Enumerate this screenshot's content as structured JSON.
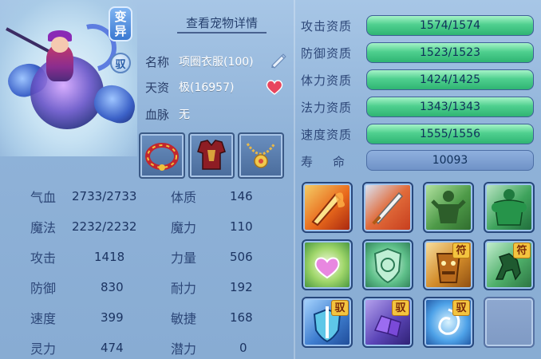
{
  "badges": {
    "mutant_top": "变",
    "mutant_bottom": "异",
    "tame": "驭"
  },
  "pet": {
    "detail_link": "查看宠物详情",
    "name_key": "名称",
    "name_value": "项圈衣服(100)",
    "talent_key": "天资",
    "talent_value": "极(16957)",
    "bloodline_key": "血脉",
    "bloodline_value": "无"
  },
  "equipment": [
    {
      "icon": "ring-collar-icon"
    },
    {
      "icon": "armor-icon"
    },
    {
      "icon": "necklace-icon"
    }
  ],
  "attributes": [
    {
      "label": "攻击资质",
      "current": 1574,
      "max": 1574,
      "text": "1574/1574"
    },
    {
      "label": "防御资质",
      "current": 1523,
      "max": 1523,
      "text": "1523/1523"
    },
    {
      "label": "体力资质",
      "current": 1424,
      "max": 1425,
      "text": "1424/1425"
    },
    {
      "label": "法力资质",
      "current": 1343,
      "max": 1343,
      "text": "1343/1343"
    },
    {
      "label": "速度资质",
      "current": 1555,
      "max": 1556,
      "text": "1555/1556"
    }
  ],
  "life": {
    "label_1": "寿",
    "label_2": "命",
    "value": "10093"
  },
  "stats_left": [
    {
      "label": "气血",
      "value": "2733/2733"
    },
    {
      "label": "魔法",
      "value": "2232/2232"
    },
    {
      "label": "攻击",
      "value": "1418"
    },
    {
      "label": "防御",
      "value": "830"
    },
    {
      "label": "速度",
      "value": "399"
    },
    {
      "label": "灵力",
      "value": "474"
    }
  ],
  "stats_right": [
    {
      "label": "体质",
      "value": "146"
    },
    {
      "label": "魔力",
      "value": "110"
    },
    {
      "label": "力量",
      "value": "506"
    },
    {
      "label": "耐力",
      "value": "192"
    },
    {
      "label": "敏捷",
      "value": "168"
    },
    {
      "label": "潜力",
      "value": "0"
    }
  ],
  "skills": [
    {
      "icon": "flaming-sword-icon",
      "tag": ""
    },
    {
      "icon": "slashing-sword-icon",
      "tag": ""
    },
    {
      "icon": "green-warrior-icon",
      "tag": ""
    },
    {
      "icon": "muscle-giant-icon",
      "tag": ""
    },
    {
      "icon": "heart-crystal-icon",
      "tag": ""
    },
    {
      "icon": "shield-swirl-icon",
      "tag": ""
    },
    {
      "icon": "rune-totem-icon",
      "tag": "符"
    },
    {
      "icon": "horse-rune-icon",
      "tag": "符"
    },
    {
      "icon": "sword-shield-icon",
      "tag": "驭"
    },
    {
      "icon": "purple-crystal-icon",
      "tag": "驭"
    },
    {
      "icon": "blue-vortex-icon",
      "tag": "驭"
    },
    {
      "icon": "empty-slot-icon",
      "tag": ""
    }
  ],
  "colors": {
    "bar_green": "#4fd08f",
    "bar_bg": "#5b7cb4",
    "label_blue": "#2d4778",
    "tag_gold": "#f3c43f"
  }
}
